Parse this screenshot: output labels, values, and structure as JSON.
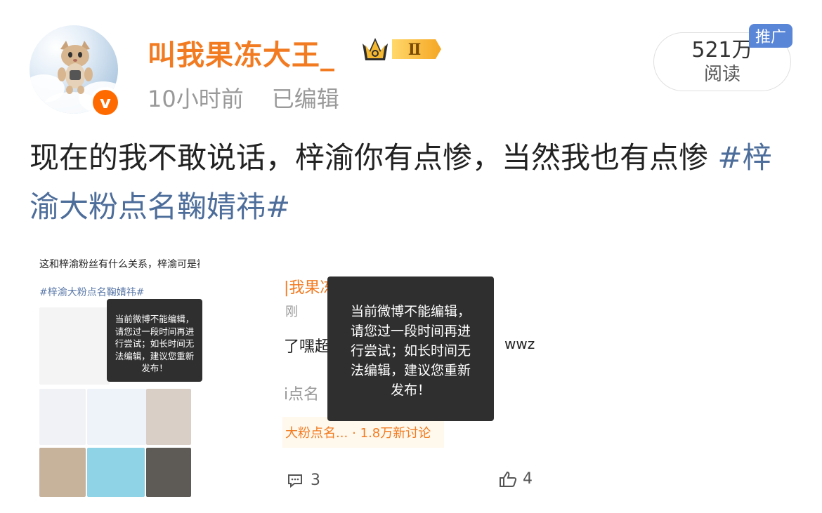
{
  "post": {
    "username": "叫我果冻大王_",
    "time": "10小时前",
    "edit_status": "已编辑",
    "reads_count": "521万",
    "reads_label": "阅读",
    "promo_tag": "推广",
    "level_badge": "Ⅱ",
    "content_text": "现在的我不敢说话，梓渝你有点惨，当然我也有点惨",
    "content_hashtag": "#梓渝大粉点名鞠婧祎#"
  },
  "embedded_left": {
    "title": "这和梓渝粉丝有什么关系，梓渝可是被开了黑超啊",
    "hashtag": "#梓渝大粉点名鞠婧祎#",
    "toast": [
      "当前微博不能编辑，",
      "请您过一段时间再进",
      "行尝试；如长时间无",
      "法编辑，建议您重新",
      "发布！"
    ]
  },
  "embedded_right": {
    "username_partial": "|我果冻",
    "time_partial": "刚",
    "text_partial": "了嘿超",
    "text_right": "wwz",
    "hashtag_partial": "i点名",
    "topic_label": "大粉点名...",
    "topic_discussion": "· 1.8万新讨论",
    "comments_count": "3",
    "likes_count": "4",
    "toast": [
      "当前微博不能编辑，",
      "请您过一段时间再进",
      "行尝试；如长时间无",
      "法编辑，建议您重新",
      "发布！"
    ]
  },
  "icons": {
    "verified": "verified-v-icon",
    "crown": "crown-level-icon",
    "comment": "comment-icon",
    "like": "thumbs-up-icon"
  },
  "colors": {
    "username": "#f27b21",
    "hashtag": "#4d6d9a",
    "promo": "#5a86d8",
    "toast_bg": "#2f2f2f"
  }
}
